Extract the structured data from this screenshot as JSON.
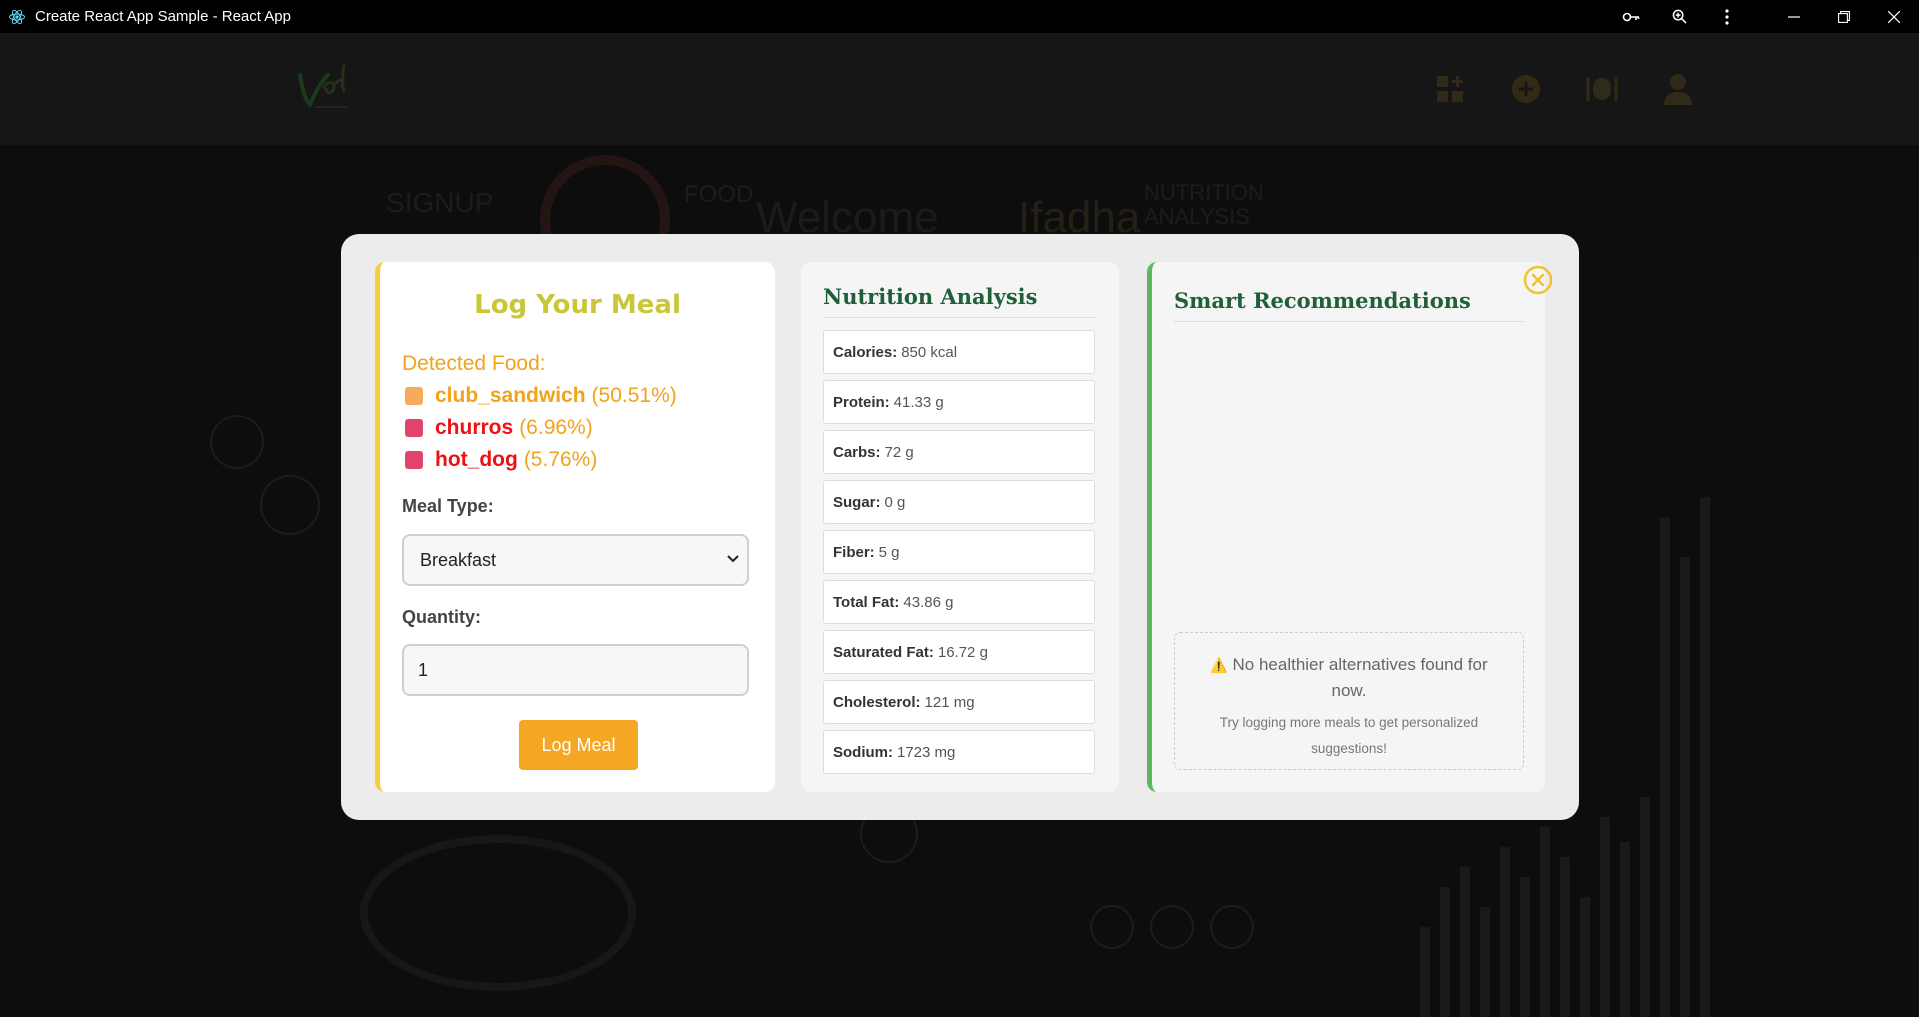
{
  "window": {
    "title": "Create React App Sample - React App"
  },
  "modal": {
    "log": {
      "title": "Log Your Meal",
      "detected_label": "Detected Food:",
      "foods": [
        {
          "name": "club_sandwich",
          "pct": "(50.51%)",
          "color": "#f7a95c",
          "name_color": "#f2a21b"
        },
        {
          "name": "churros",
          "pct": "(6.96%)",
          "color": "#e0446a",
          "name_color": "#ee1111"
        },
        {
          "name": "hot_dog",
          "pct": "(5.76%)",
          "color": "#e0446a",
          "name_color": "#ee1111"
        }
      ],
      "meal_type_label": "Meal Type:",
      "meal_type_value": "Breakfast",
      "quantity_label": "Quantity:",
      "quantity_value": "1",
      "button_label": "Log Meal"
    },
    "nutrition": {
      "title": "Nutrition Analysis",
      "rows": [
        {
          "label": "Calories:",
          "value": "850 kcal"
        },
        {
          "label": "Protein:",
          "value": "41.33 g"
        },
        {
          "label": "Carbs:",
          "value": "72 g"
        },
        {
          "label": "Sugar:",
          "value": "0 g"
        },
        {
          "label": "Fiber:",
          "value": "5 g"
        },
        {
          "label": "Total Fat:",
          "value": "43.86 g"
        },
        {
          "label": "Saturated Fat:",
          "value": "16.72 g"
        },
        {
          "label": "Cholesterol:",
          "value": "121 mg"
        },
        {
          "label": "Sodium:",
          "value": "1723 mg"
        }
      ]
    },
    "recommendations": {
      "title": "Smart Recommendations",
      "empty_icon": "⚠️",
      "empty_title": "No healthier alternatives found for now.",
      "empty_hint": "Try logging more meals to get personalized suggestions!"
    }
  },
  "background": {
    "welcome": "Welcome",
    "name": "Ifadha",
    "signup": "SIGNUP",
    "food": "FOOD",
    "nutrition": "NUTRITION ANALYSIS"
  },
  "colors": {
    "accent": "#f5a623",
    "green": "#1f5f3a",
    "yellow": "#f7cd3a"
  }
}
